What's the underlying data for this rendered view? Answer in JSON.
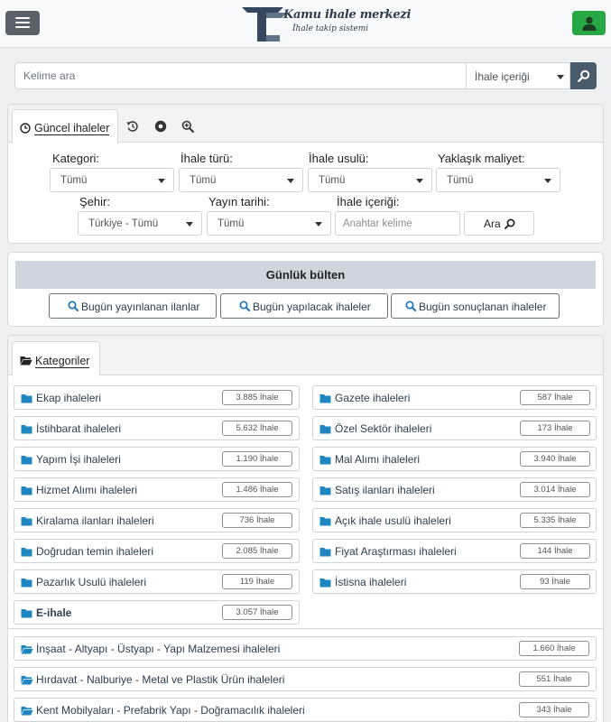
{
  "header": {
    "logo_title": "Kamu ihale merkezi",
    "logo_subtitle": "İhale takip sistemi",
    "menu_icon": "hamburger-icon",
    "user_icon": "user-icon",
    "colors": {
      "menu_button": "#5b6168",
      "user_button": "#28a745",
      "search_button": "#4a5b6c"
    }
  },
  "search": {
    "placeholder": "Kelime ara",
    "scope_selected": "İhale içeriği"
  },
  "filter_panel": {
    "active_tab": "Güncel ihaleler",
    "tab_icons": [
      "clock-icon",
      "history-icon",
      "record-icon",
      "zoom-in-icon"
    ],
    "kategori_label": "Kategori:",
    "kategori_value": "Tümü",
    "ihale_turu_label": "İhale türü:",
    "ihale_turu_value": "Tümü",
    "ihale_usulu_label": "İhale usulü:",
    "ihale_usulu_value": "Tümü",
    "maliyet_label": "Yaklaşık maliyet:",
    "maliyet_value": "Tümü",
    "sehir_label": "Şehir:",
    "sehir_value": "Türkiye - Tümü",
    "yayin_label": "Yayın tarihi:",
    "yayin_value": "Tümü",
    "icerik_label": "İhale içeriği:",
    "icerik_placeholder": "Anahtar kelime",
    "ara_label": "Ara"
  },
  "bulletin": {
    "title": "Günlük bülten",
    "buttons": [
      "Bugün yayınlanan ilanlar",
      "Bugün yapılacak ihaleler",
      "Bugün sonuçlanan ihaleler"
    ]
  },
  "categories": {
    "tab_label": "Kategoriler",
    "left": [
      {
        "name": "Ekap ihaleleri",
        "count": "3.885 İhale"
      },
      {
        "name": "İstihbarat ihaleleri",
        "count": "5.632 İhale"
      },
      {
        "name": "Yapım İşi ihaleleri",
        "count": "1.190 İhale"
      },
      {
        "name": "Hizmet Alımı ihaleleri",
        "count": "1.486 İhale"
      },
      {
        "name": "Kiralama ilanları ihaleleri",
        "count": "736 İhale"
      },
      {
        "name": "Doğrudan temin ihaleleri",
        "count": "2.085 İhale"
      },
      {
        "name": "Pazarlık Usulü ihaleleri",
        "count": "119 İhale"
      },
      {
        "name": "E-ihale",
        "count": "3.057 İhale"
      }
    ],
    "right": [
      {
        "name": "Gazete ihaleleri",
        "count": "587 İhale"
      },
      {
        "name": "Özel Sektör ihaleleri",
        "count": "173 İhale"
      },
      {
        "name": "Mal Alımı ihaleleri",
        "count": "3.940 İhale"
      },
      {
        "name": "Satış ilanları ihaleleri",
        "count": "3.014 İhale"
      },
      {
        "name": "Açık ihale usulü ihaleleri",
        "count": "5.335 İhale"
      },
      {
        "name": "Fiyat Araştırması ihaleleri",
        "count": "144 İhale"
      },
      {
        "name": "İstisna ihaleleri",
        "count": "93 İhale"
      }
    ],
    "sectors": [
      {
        "name": "İnşaat - Altyapı - Üstyapı - Yapı Malzemesi ihaleleri",
        "count": "1.660 İhale"
      },
      {
        "name": "Hırdavat - Nalburiye - Metal ve Plastik Ürün ihaleleri",
        "count": "551 İhale"
      },
      {
        "name": "Kent Mobilyaları - Prefabrik Yapı - Doğramacılık ihaleleri",
        "count": "343 İhale"
      }
    ]
  }
}
